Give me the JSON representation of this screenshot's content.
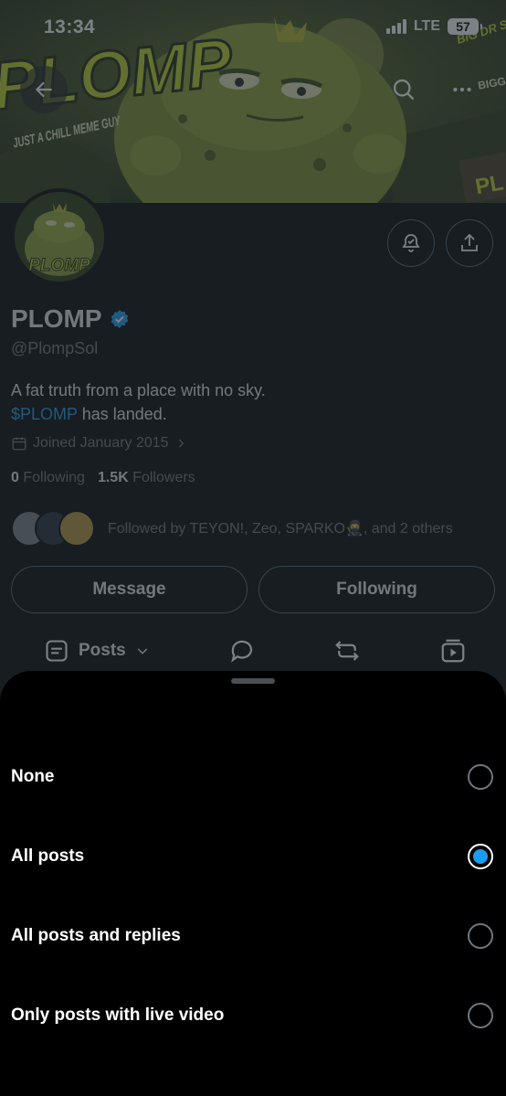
{
  "status_bar": {
    "time": "13:34",
    "network": "LTE",
    "battery": "57"
  },
  "banner": {
    "logo_text": "PLOMP",
    "tagline": "JUST A CHILL MEME GUY",
    "corner_text_1": "BIG DR SAME",
    "corner_text_2": "BIGG THA AV",
    "sign_text": "PL"
  },
  "avatar": {
    "logo_text": "PLOMP"
  },
  "profile": {
    "display_name": "PLOMP",
    "handle": "@PlompSol",
    "bio_line1": "A fat truth from a place with no sky.",
    "bio_cashtag": "$PLOMP",
    "bio_line2_rest": " has landed.",
    "joined": "Joined January 2015",
    "following_count": "0",
    "following_label": "Following",
    "followers_count": "1.5K",
    "followers_label": "Followers",
    "followed_by": "Followed by TEYON!, Zeo, SPARKO🥷, and 2 others"
  },
  "buttons": {
    "message": "Message",
    "following": "Following"
  },
  "tabs": {
    "posts": "Posts"
  },
  "notification_sheet": {
    "options": [
      {
        "label": "None",
        "selected": false
      },
      {
        "label": "All posts",
        "selected": true
      },
      {
        "label": "All posts and replies",
        "selected": false
      },
      {
        "label": "Only posts with live video",
        "selected": false
      }
    ]
  },
  "colors": {
    "accent": "#1d9bf0",
    "background": "#000000",
    "text": "#e7e9ea",
    "muted": "#71767b"
  },
  "icons": [
    "back-arrow-icon",
    "search-icon",
    "more-icon",
    "bell-check-icon",
    "share-icon",
    "verified-badge-icon",
    "calendar-icon",
    "chevron-right-icon",
    "posts-icon",
    "chevron-down-icon",
    "reply-icon",
    "repost-icon",
    "media-icon"
  ]
}
